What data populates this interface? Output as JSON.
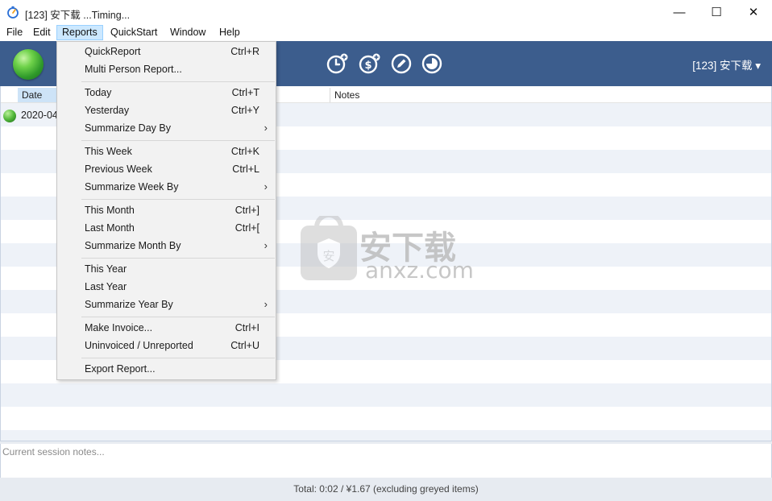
{
  "window": {
    "title": "[123] 安下载 ...Timing...",
    "min_glyph": "—",
    "max_glyph": "☐",
    "close_glyph": "✕"
  },
  "menubar": [
    "File",
    "Edit",
    "Reports",
    "QuickStart",
    "Window",
    "Help"
  ],
  "toolbar": {
    "user": "[123] 安下载 ▾",
    "icons": [
      "add-timer-icon",
      "add-expense-icon",
      "edit-icon",
      "pie-chart-icon"
    ]
  },
  "grid": {
    "columns": {
      "date": "Date",
      "notes": "Notes"
    },
    "rows": [
      {
        "date": "2020-04"
      }
    ]
  },
  "notes_placeholder": "Current session notes...",
  "footer": "Total: 0:02 / ¥1.67 (excluding greyed items)",
  "reports_menu": {
    "items": [
      {
        "label": "QuickReport",
        "shortcut": "Ctrl+R"
      },
      {
        "label": "Multi Person Report...",
        "shortcut": ""
      },
      {
        "label": "Today",
        "shortcut": "Ctrl+T"
      },
      {
        "label": "Yesterday",
        "shortcut": "Ctrl+Y"
      },
      {
        "label": "Summarize Day By",
        "arrow": "›"
      },
      {
        "label": "This Week",
        "shortcut": "Ctrl+K"
      },
      {
        "label": "Previous Week",
        "shortcut": "Ctrl+L"
      },
      {
        "label": "Summarize Week By",
        "arrow": "›"
      },
      {
        "label": "This Month",
        "shortcut": "Ctrl+]"
      },
      {
        "label": "Last Month",
        "shortcut": "Ctrl+["
      },
      {
        "label": "Summarize Month By",
        "arrow": "›"
      },
      {
        "label": "This Year",
        "shortcut": ""
      },
      {
        "label": "Last Year",
        "shortcut": ""
      },
      {
        "label": "Summarize Year By",
        "arrow": "›"
      },
      {
        "label": "Make Invoice...",
        "shortcut": "Ctrl+I"
      },
      {
        "label": "Uninvoiced / Unreported",
        "shortcut": "Ctrl+U"
      },
      {
        "label": "Export Report...",
        "shortcut": ""
      }
    ]
  },
  "watermark": {
    "cn": "安下载",
    "en": "anxz.com"
  },
  "colors": {
    "toolbar": "#3c5d8d",
    "menu_active": "#cce8ff",
    "stripe": "#eef2f8"
  }
}
